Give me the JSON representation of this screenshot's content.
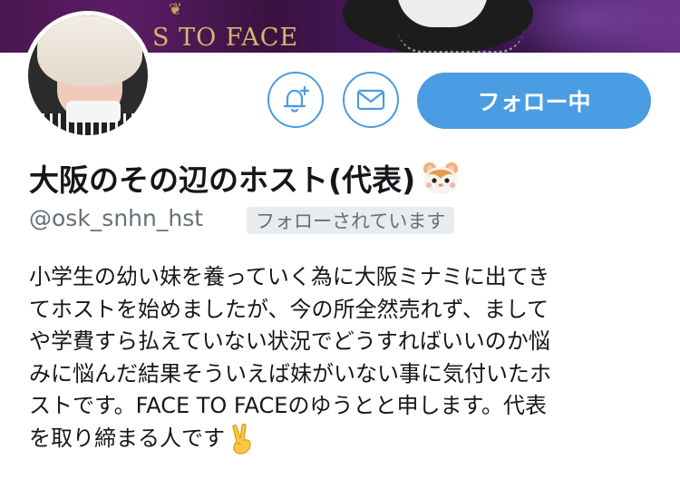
{
  "banner": {
    "text": "S TO FACE"
  },
  "profile": {
    "display_name": "大阪のその辺のホスト(代表)",
    "name_emoji": "hamster-face",
    "handle": "@osk_snhn_hst",
    "follows_you_badge": "フォローされています",
    "bio_lines": [
      "小学生の幼い妹を養っていく為に大阪ミナミに出てき",
      "てホストを始めましたが、今の所全然売れず、まして",
      "や学費すら払えていない状況でどうすればいいのか悩",
      "みに悩んだ結果そういえば妹がいない事に気付いたホ",
      "ストです。FACE TO FACEのゆうとと申します。代表",
      "を取り締まる人です"
    ],
    "bio_end_emoji": "victory-hand"
  },
  "actions": {
    "follow_label": "フォロー中",
    "notification_icon": "bell-plus-icon",
    "message_icon": "envelope-icon",
    "accent_color": "#4a9de3"
  }
}
